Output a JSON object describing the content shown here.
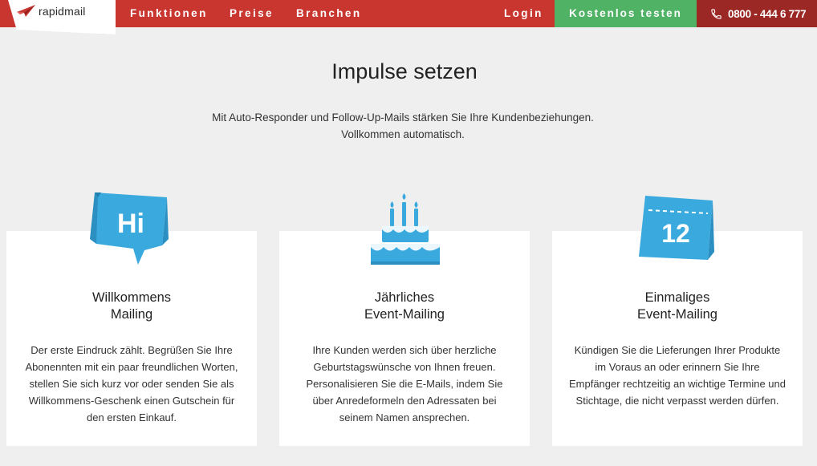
{
  "header": {
    "logo_text": "rapidmail",
    "nav": [
      {
        "label": "Funktionen"
      },
      {
        "label": "Preise"
      },
      {
        "label": "Branchen"
      }
    ],
    "login_label": "Login",
    "cta_label": "Kostenlos testen",
    "phone": "0800 - 444 6 777",
    "colors": {
      "bar": "#c93630",
      "cta": "#4fb264",
      "phone_bg": "#9b2824",
      "accent": "#3aa9de"
    }
  },
  "hero": {
    "title": "Impulse setzen",
    "subtitle_line1": "Mit Auto-Responder und Follow-Up-Mails stärken Sie Ihre Kundenbeziehungen.",
    "subtitle_line2": "Vollkommen automatisch."
  },
  "cards": [
    {
      "icon": "speech-bubble-hi-icon",
      "icon_text": "Hi",
      "title_line1": "Willkommens",
      "title_line2": "Mailing",
      "text": "Der erste Eindruck zählt. Begrüßen Sie Ihre Abonennten mit ein paar freundlichen Worten, stellen Sie sich kurz vor oder senden Sie als Willkommens-Geschenk einen Gutschein für den ersten Einkauf."
    },
    {
      "icon": "birthday-cake-icon",
      "title_line1": "Jährliches",
      "title_line2": "Event-Mailing",
      "text": "Ihre Kunden werden sich über herzliche Geburtstagswünsche von Ihnen freuen. Personalisieren Sie die E-Mails, indem Sie über Anredeformeln den Adressaten bei seinem Namen ansprechen."
    },
    {
      "icon": "calendar-icon",
      "icon_text": "12",
      "title_line1": "Einmaliges",
      "title_line2": "Event-Mailing",
      "text": "Kündigen Sie die Lieferungen Ihrer Produkte im Voraus an oder erinnern Sie Ihre Empfänger rechtzeitig an wichtige Termine und Stichtage, die nicht verpasst werden dürfen."
    }
  ]
}
